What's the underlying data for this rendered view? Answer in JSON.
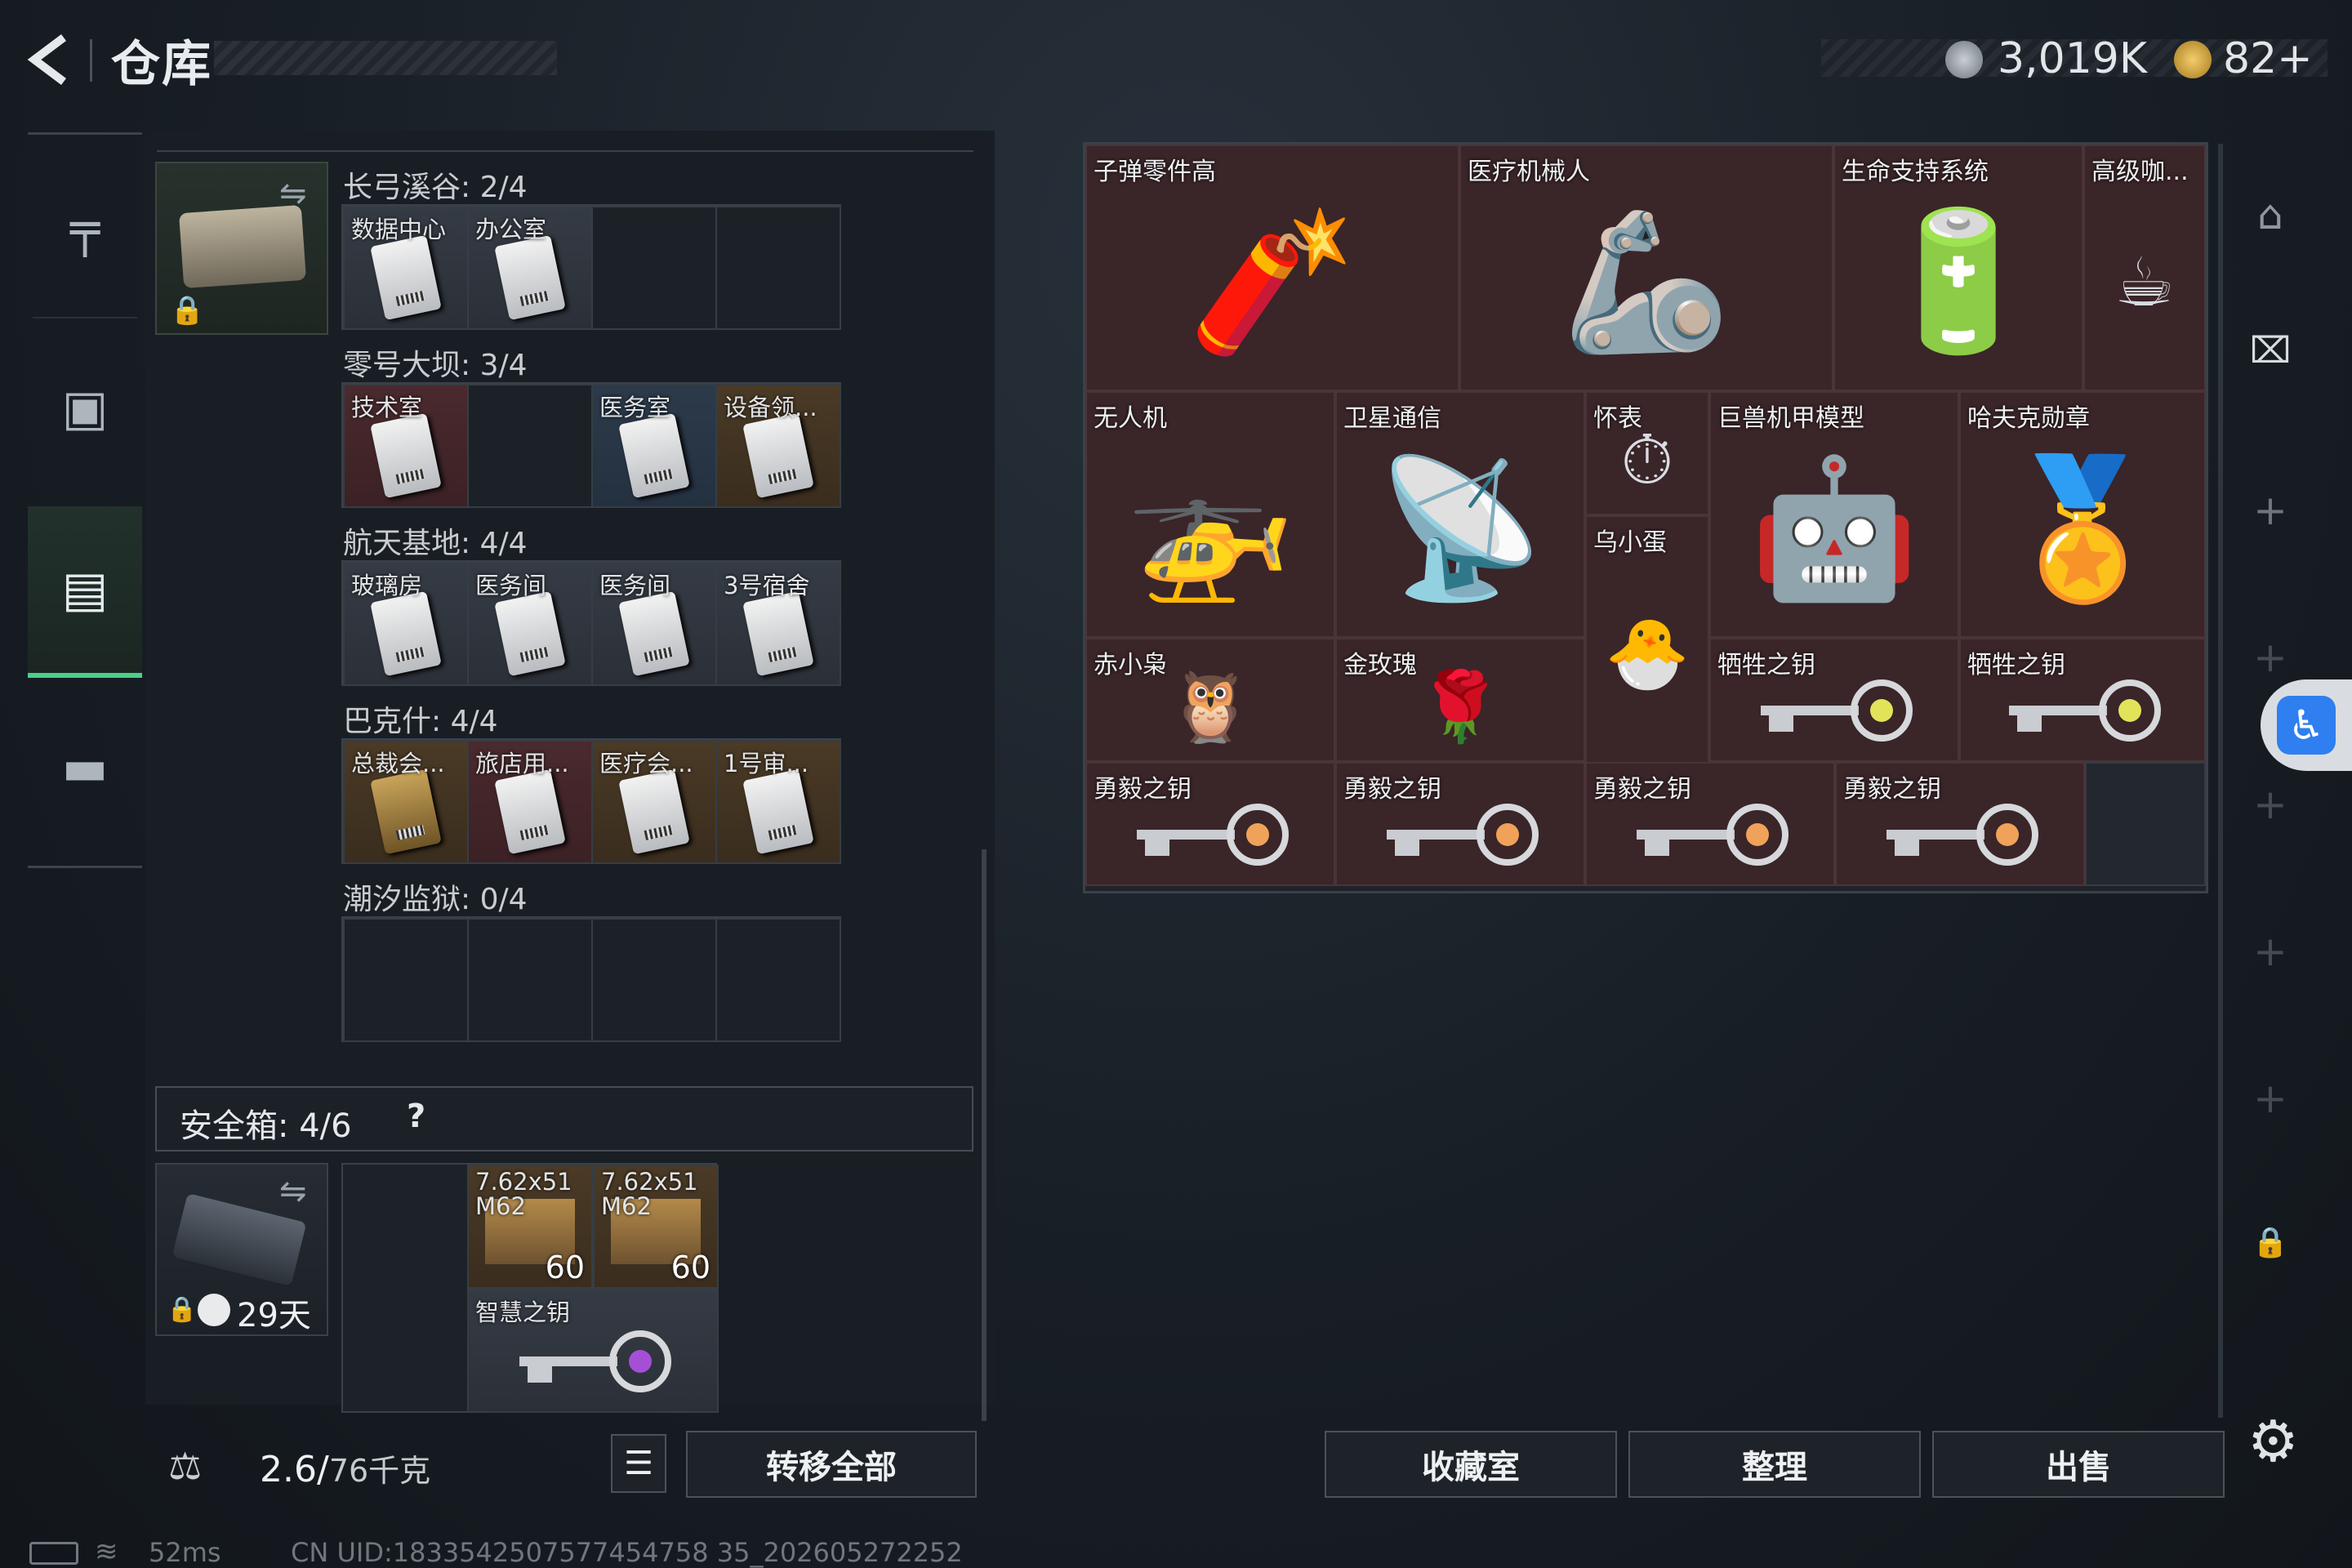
{
  "header": {
    "title": "仓库",
    "currency1": "3,019K",
    "currency2": "82+"
  },
  "left_nav": {
    "items": [
      {
        "icon": "gun-icon"
      },
      {
        "icon": "backpack-icon"
      },
      {
        "icon": "vest-icon"
      },
      {
        "icon": "briefcase-icon"
      }
    ]
  },
  "key_wallet": {
    "sections": [
      {
        "label": "长弓溪谷: 2/4",
        "slots": [
          {
            "label": "数据中心",
            "color": "gray"
          },
          {
            "label": "办公室",
            "color": "gray"
          },
          {
            "label": "",
            "color": "empty"
          },
          {
            "label": "",
            "color": "empty"
          }
        ]
      },
      {
        "label": "零号大坝: 3/4",
        "slots": [
          {
            "label": "技术室",
            "color": "red"
          },
          {
            "label": "",
            "color": "empty"
          },
          {
            "label": "医务室",
            "color": "blue"
          },
          {
            "label": "设备领...",
            "color": "gold"
          }
        ]
      },
      {
        "label": "航天基地: 4/4",
        "slots": [
          {
            "label": "玻璃房",
            "color": "gray"
          },
          {
            "label": "医务间",
            "color": "gray"
          },
          {
            "label": "医务间",
            "color": "gray"
          },
          {
            "label": "3号宿舍",
            "color": "gray"
          }
        ]
      },
      {
        "label": "巴克什: 4/4",
        "slots": [
          {
            "label": "总裁会...",
            "color": "gold"
          },
          {
            "label": "旅店用...",
            "color": "red"
          },
          {
            "label": "医疗会...",
            "color": "gold"
          },
          {
            "label": "1号审...",
            "color": "gold"
          }
        ]
      },
      {
        "label": "潮汐监狱: 0/4",
        "slots": [
          {
            "label": "",
            "color": "empty"
          },
          {
            "label": "",
            "color": "empty"
          },
          {
            "label": "",
            "color": "empty"
          },
          {
            "label": "",
            "color": "empty"
          }
        ]
      }
    ]
  },
  "safe_box": {
    "label": "安全箱:  4/6",
    "help": "?",
    "timer": "29天",
    "items": [
      {
        "label": "7.62x51 M62",
        "count": "60"
      },
      {
        "label": "7.62x51 M62",
        "count": "60"
      },
      {
        "label": "智慧之钥"
      }
    ]
  },
  "weight": {
    "value": "2.6/",
    "max": "76千克"
  },
  "buttons": {
    "transfer_all": "转移全部",
    "collection": "收藏室",
    "organize": "整理",
    "sell": "出售"
  },
  "storage_items": [
    {
      "label": "子弹零件高"
    },
    {
      "label": "医疗机械人"
    },
    {
      "label": "生命支持系统"
    },
    {
      "label": "高级咖..."
    },
    {
      "label": "无人机"
    },
    {
      "label": "卫星通信"
    },
    {
      "label": "怀表"
    },
    {
      "label": "巨兽机甲模型"
    },
    {
      "label": "哈夫克勋章"
    },
    {
      "label": "乌小蛋"
    },
    {
      "label": "赤小枭"
    },
    {
      "label": "金玫瑰"
    },
    {
      "label": "牺牲之钥"
    },
    {
      "label": "牺牲之钥"
    },
    {
      "label": "勇毅之钥"
    },
    {
      "label": "勇毅之钥"
    },
    {
      "label": "勇毅之钥"
    },
    {
      "label": "勇毅之钥"
    }
  ],
  "status": {
    "ping": "52ms",
    "uid": "CN UID:1833542507577454758 35_202605272252"
  }
}
